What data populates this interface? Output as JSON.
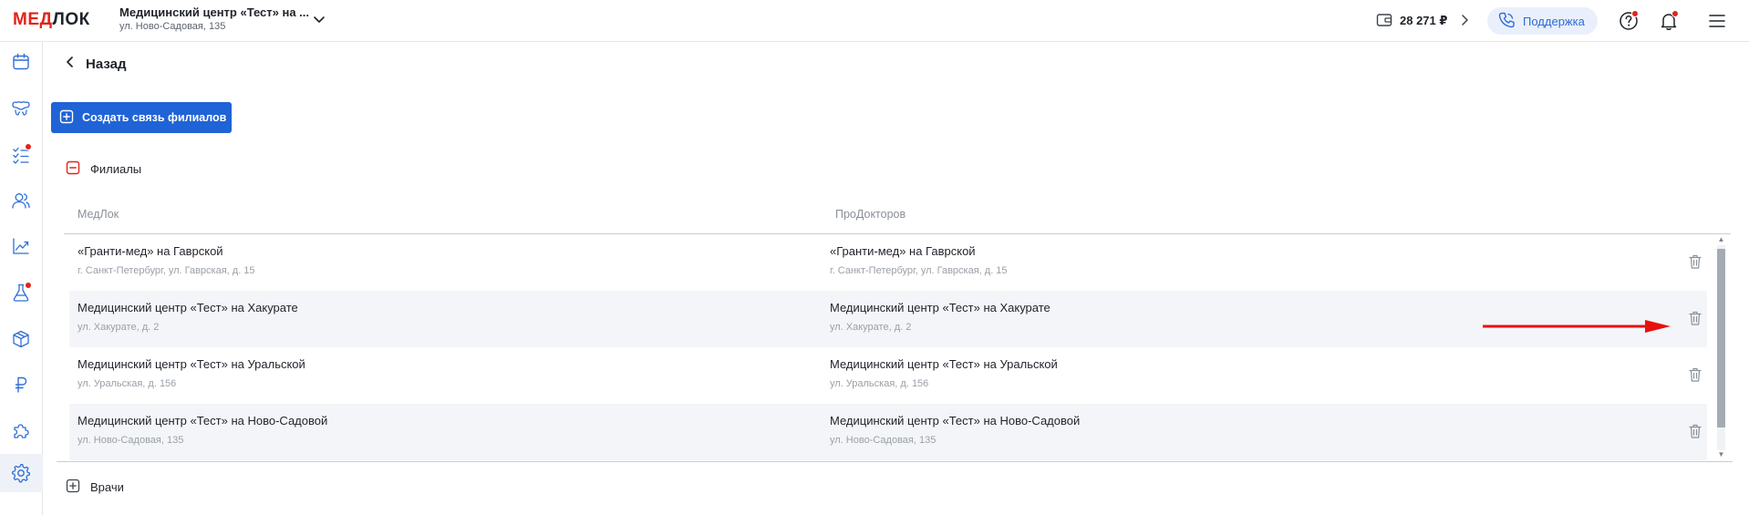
{
  "header": {
    "logo_part1": "МЕД",
    "logo_part2": "ЛОК",
    "clinic_name": "Медицинский центр «Тест» на ...",
    "clinic_address": "ул. Ново-Садовая, 135",
    "balance": "28 271 ₽",
    "support_label": "Поддержка"
  },
  "nav": {
    "back_label": "Назад"
  },
  "actions": {
    "create_link_label": "Создать связь филиалов"
  },
  "sections": {
    "branches_label": "Филиалы",
    "doctors_label": "Врачи"
  },
  "table": {
    "columns": [
      "МедЛок",
      "ПроДокторов"
    ],
    "rows": [
      {
        "medlok_name": "«Гранти-мед» на Гаврской",
        "medlok_address": "г. Санкт-Петербург, ул. Гаврская, д. 15",
        "prodoctorov_name": "«Гранти-мед» на Гаврской",
        "prodoctorov_address": "г. Санкт-Петербург, ул. Гаврская, д. 15"
      },
      {
        "medlok_name": "Медицинский центр «Тест» на Хакурате",
        "medlok_address": "ул. Хакурате, д. 2",
        "prodoctorov_name": "Медицинский центр «Тест» на Хакурате",
        "prodoctorov_address": "ул. Хакурате, д. 2"
      },
      {
        "medlok_name": "Медицинский центр «Тест» на Уральской",
        "medlok_address": "ул. Уральская, д. 156",
        "prodoctorov_name": "Медицинский центр «Тест» на Уральской",
        "prodoctorov_address": "ул. Уральская, д. 156"
      },
      {
        "medlok_name": "Медицинский центр «Тест» на Ново-Садовой",
        "medlok_address": "ул. Ново-Садовая, 135",
        "prodoctorov_name": "Медицинский центр «Тест» на Ново-Садовой",
        "prodoctorov_address": "ул. Ново-Садовая, 135"
      }
    ]
  },
  "icons": {
    "sidebar": [
      "calendar-icon",
      "dental-icon",
      "checklist-icon",
      "users-icon",
      "analytics-icon",
      "lab-flask-icon",
      "box-icon",
      "ruble-icon",
      "puzzle-icon",
      "settings-icon"
    ],
    "delete": "trash-icon"
  },
  "colors": {
    "brand_red": "#e2231a",
    "primary_blue": "#1f63d6",
    "support_bg": "#e9f0fb",
    "annotation_arrow": "#e8110f"
  }
}
